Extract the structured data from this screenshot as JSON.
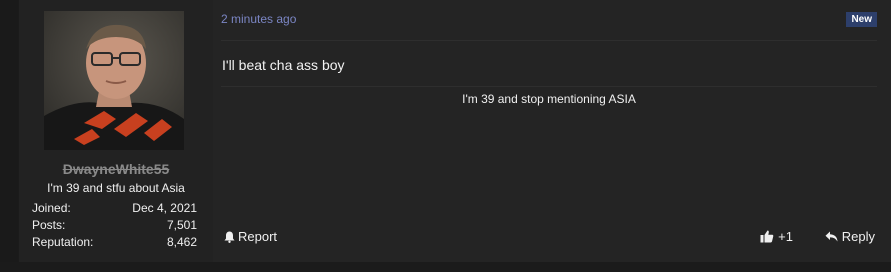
{
  "user": {
    "name": "DwayneWhite55",
    "title": "I'm 39 and stfu about Asia",
    "stats": [
      {
        "label": "Joined:",
        "value": "Dec 4, 2021"
      },
      {
        "label": "Posts:",
        "value": "7,501"
      },
      {
        "label": "Reputation:",
        "value": "8,462"
      }
    ]
  },
  "post": {
    "timestamp": "2 minutes ago",
    "badge": "New",
    "body": "I'll beat cha ass boy",
    "signature": "I'm 39 and stop mentioning ASIA"
  },
  "actions": {
    "report": "Report",
    "like": "+1",
    "reply": "Reply"
  },
  "icons": {
    "report": "bell-icon",
    "like": "thumbs-up-icon",
    "reply": "reply-arrow-icon"
  },
  "colors": {
    "link": "#7b86c4",
    "badge": "#2d3f6b"
  }
}
